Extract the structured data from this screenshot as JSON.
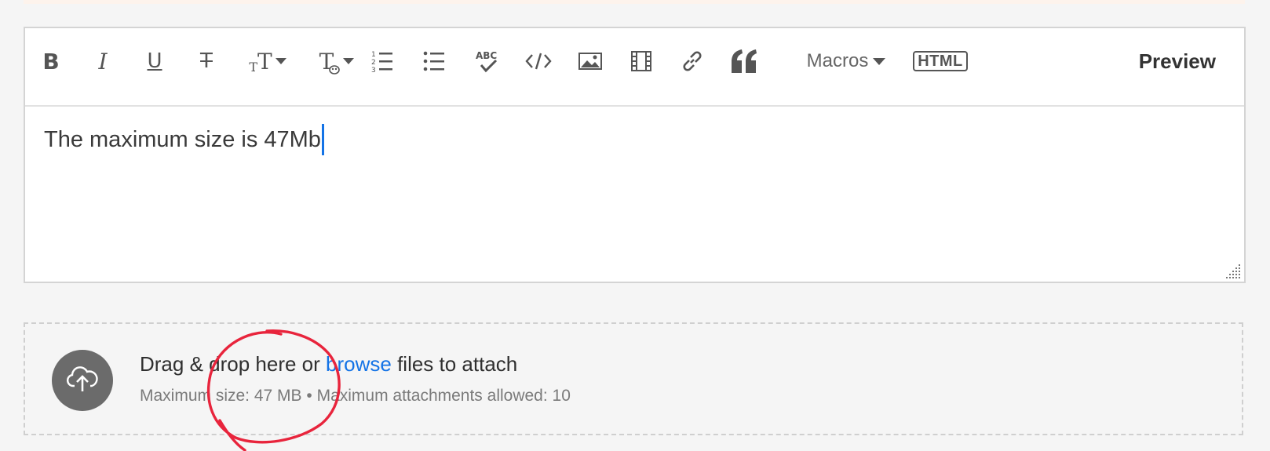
{
  "toolbar": {
    "bold": "B",
    "italic": "I",
    "underline": "U",
    "strikethrough": "T",
    "font_size": "T",
    "font_color": "T",
    "macros_label": "Macros",
    "html_label": "HTML",
    "preview_label": "Preview",
    "icons": [
      "bold-icon",
      "italic-icon",
      "underline-icon",
      "strikethrough-icon",
      "font-size-icon",
      "font-color-icon",
      "numbered-list-icon",
      "bulleted-list-icon",
      "spellcheck-icon",
      "code-icon",
      "image-icon",
      "video-icon",
      "link-icon",
      "quote-icon"
    ]
  },
  "editor": {
    "content": "The maximum size is 47Mb"
  },
  "dropzone": {
    "text_before": "Drag & drop here or ",
    "browse_link": "browse",
    "text_after": " files to attach",
    "max_size": "Maximum size: 47 MB",
    "separator": " • ",
    "max_attachments": "Maximum attachments allowed: 10"
  },
  "colors": {
    "link": "#1473e6",
    "caret": "#1473e6",
    "annotation": "#e8243c",
    "upload_circle": "#6b6b6b"
  }
}
